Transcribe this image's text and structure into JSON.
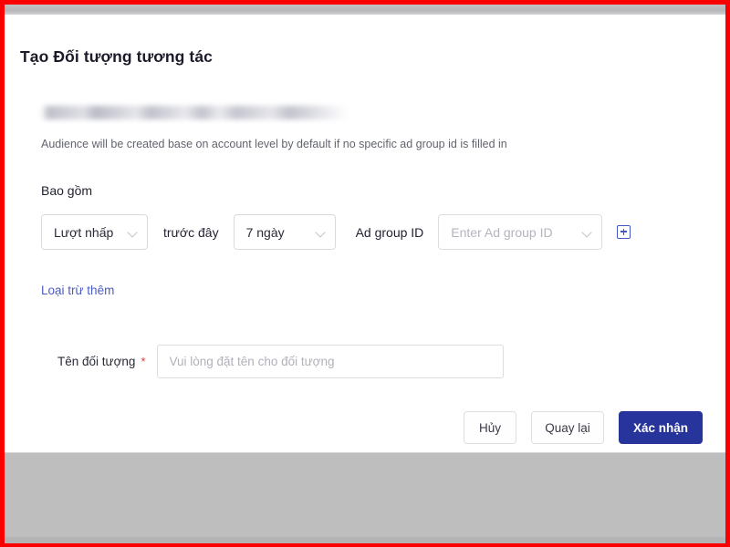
{
  "frame": {
    "border_color": "#fb0000",
    "top_strip_color": "#b6b6b9",
    "backdrop_color": "#bebebe"
  },
  "dialog": {
    "title": "Tạo Đối tượng tương tác",
    "redacted_account_line": "",
    "description": "Audience will be created base on account level by default if no specific ad group id is filled in"
  },
  "include_section": {
    "label": "Bao gồm",
    "action_select": {
      "value": "Lượt nhấp",
      "options": [
        "Lượt nhấp"
      ]
    },
    "between_text": "trước đây",
    "window_select": {
      "value": "7 ngày",
      "options": [
        "7 ngày"
      ]
    },
    "adgroup_label": "Ad group ID",
    "adgroup_select": {
      "value": "",
      "placeholder": "Enter Ad group ID"
    },
    "add_icon": "plus-square-icon",
    "add_icon_color": "#4458c4"
  },
  "exclude": {
    "link_label": "Loại trừ thêm",
    "link_color": "#4b5cc2"
  },
  "name_field": {
    "label": "Tên đối tượng",
    "required_marker": "*",
    "required_color": "#e0393e",
    "value": "",
    "placeholder": "Vui lòng đặt tên cho đối tượng"
  },
  "footer": {
    "cancel_label": "Hủy",
    "back_label": "Quay lại",
    "confirm_label": "Xác nhận",
    "confirm_color": "#27349b"
  }
}
